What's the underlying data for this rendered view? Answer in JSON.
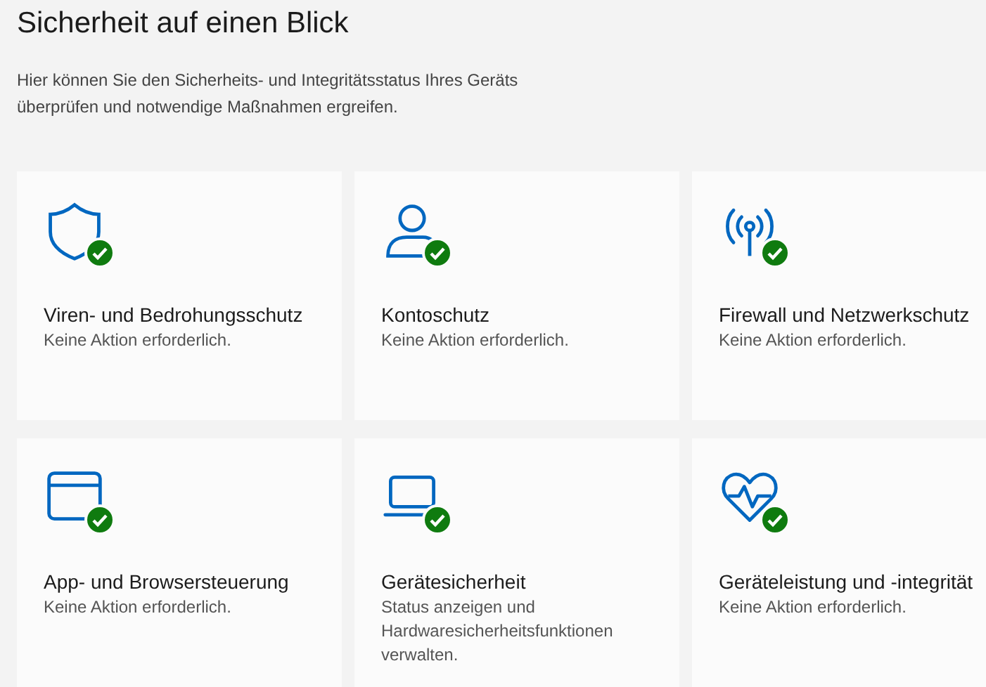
{
  "title": "Sicherheit auf einen Blick",
  "description": "Hier können Sie den Sicherheits- und Integritätsstatus Ihres Geräts überprüfen und notwendige Maßnahmen ergreifen.",
  "cards": [
    {
      "title": "Viren- und Bedrohungsschutz",
      "text": "Keine Aktion erforderlich.",
      "ok": true
    },
    {
      "title": "Kontoschutz",
      "text": "Keine Aktion erforderlich.",
      "ok": true
    },
    {
      "title": "Firewall und Netzwerkschutz",
      "text": "Keine Aktion erforderlich.",
      "ok": true
    },
    {
      "title": "App- und Browsersteuerung",
      "text": "Keine Aktion erforderlich.",
      "ok": true
    },
    {
      "title": "Gerätesicherheit",
      "text": "Status anzeigen und Hardwaresicherheitsfunktionen verwalten.",
      "ok": true
    },
    {
      "title": "Geräteleistung und -integrität",
      "text": "Keine Aktion erforderlich.",
      "ok": true
    }
  ]
}
